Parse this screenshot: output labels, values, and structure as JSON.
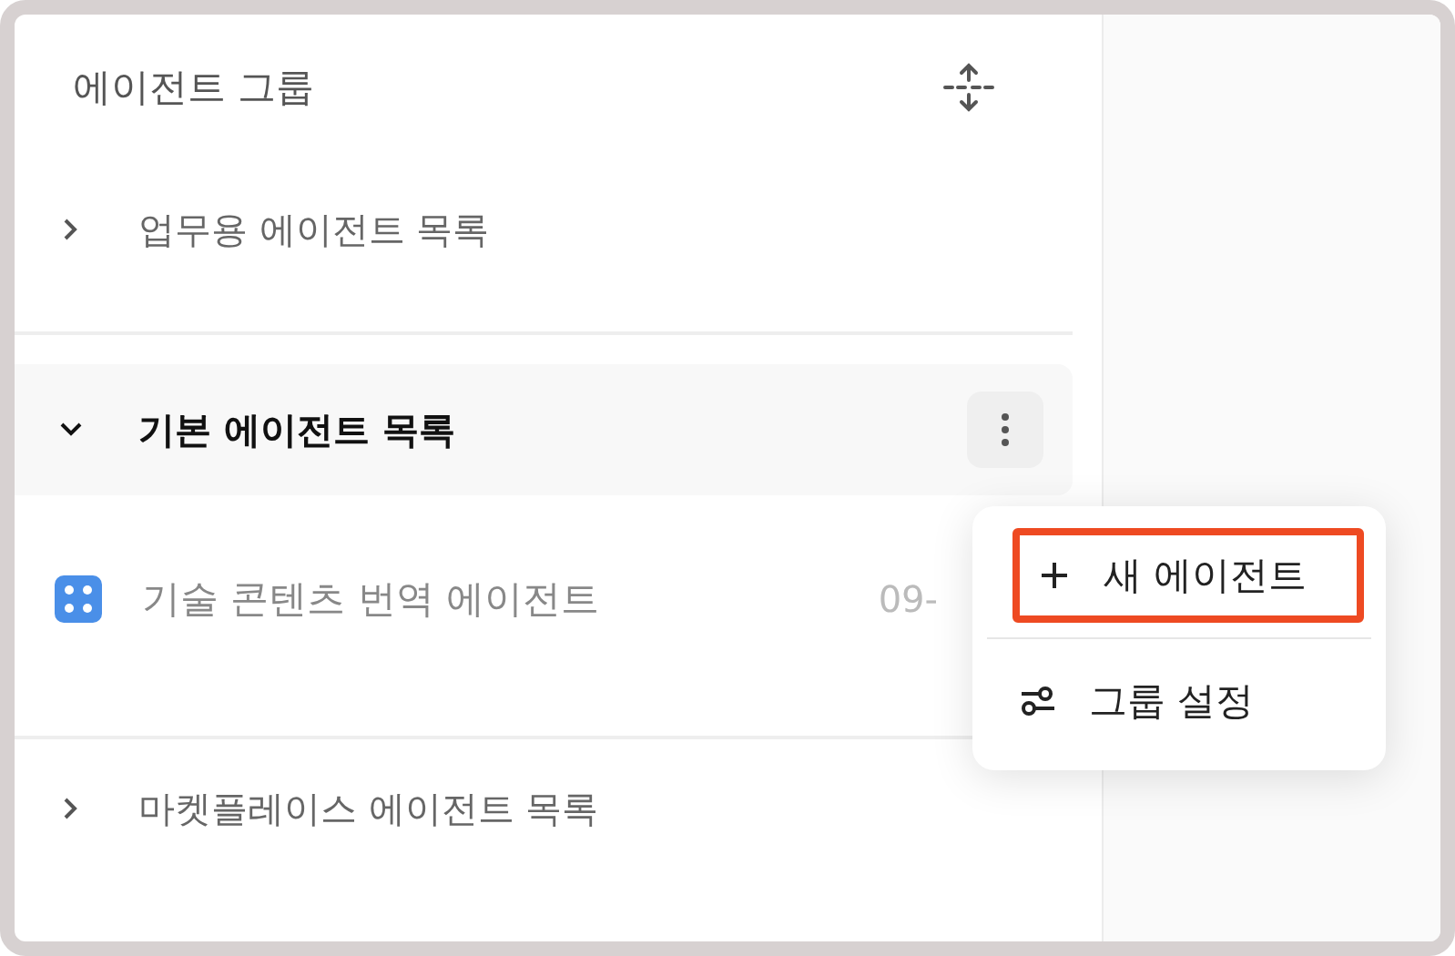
{
  "sidebar": {
    "title": "에이전트 그룹",
    "groups": [
      {
        "label": "업무용 에이전트 목록",
        "expanded": false,
        "selected": false
      },
      {
        "label": "기본 에이전트 목록",
        "expanded": true,
        "selected": true,
        "items": [
          {
            "label": "기술 콘텐츠 번역 에이전트",
            "date": "09-"
          }
        ]
      },
      {
        "label": "마켓플레이스 에이전트 목록",
        "expanded": false,
        "selected": false
      }
    ]
  },
  "menu": {
    "items": [
      {
        "kind": "add",
        "label": "새 에이전트",
        "highlighted": true
      },
      {
        "kind": "settings",
        "label": "그룹 설정",
        "highlighted": false
      }
    ]
  }
}
